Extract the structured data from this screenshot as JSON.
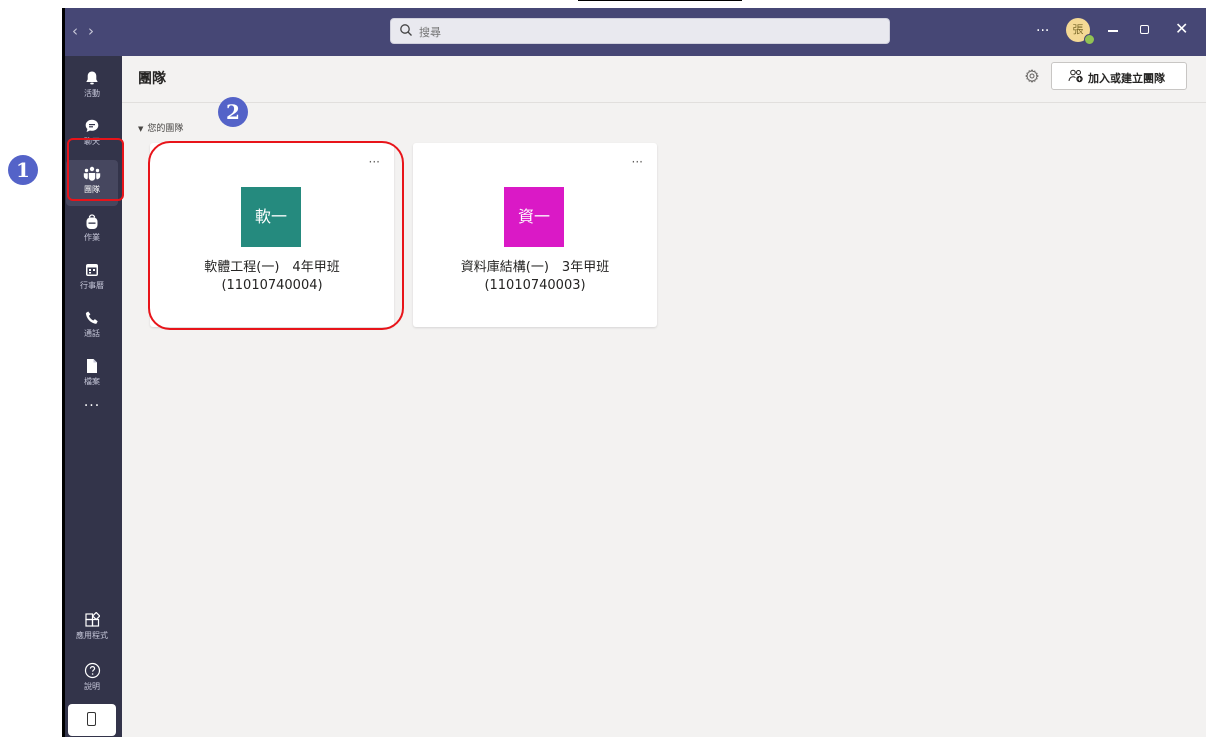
{
  "search": {
    "placeholder": "搜尋"
  },
  "titlebar": {
    "more": "···",
    "avatar_initial": "張",
    "close": "✕"
  },
  "rail": {
    "items": [
      {
        "label": "活動"
      },
      {
        "label": "聊天"
      },
      {
        "label": "團隊"
      },
      {
        "label": "作業"
      },
      {
        "label": "行事曆"
      },
      {
        "label": "通話"
      },
      {
        "label": "檔案"
      }
    ],
    "more": "···",
    "apps": {
      "label": "應用程式"
    },
    "help": {
      "label": "說明"
    }
  },
  "header": {
    "title": "團隊",
    "join_button": "加入或建立團隊"
  },
  "section": {
    "label": "您的團隊"
  },
  "teams": [
    {
      "tile": "軟一",
      "color": "#258a7e",
      "line1": "軟體工程(一)　4年甲班",
      "line2": "(11010740004)",
      "more": "···"
    },
    {
      "tile": "資一",
      "color": "#da19c6",
      "line1": "資料庫結構(一)　3年甲班",
      "line2": "(11010740003)",
      "more": "···"
    }
  ],
  "annotations": {
    "badge1": "1",
    "badge2": "2",
    "highlight_color": "#e8141a",
    "badge_color": "#5463c8"
  }
}
